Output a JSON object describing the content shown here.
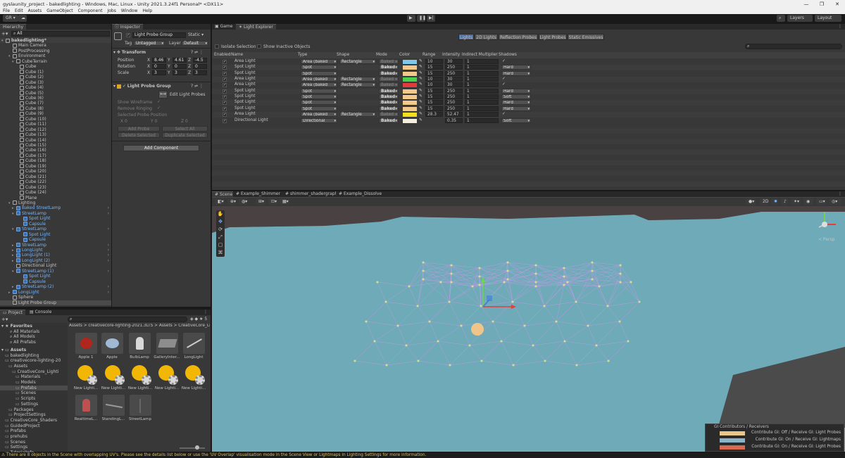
{
  "window": {
    "title": "gyslaunity_project - bakedlighting - Windows, Mac, Linux - Unity 2021.3.24f1 Personal* <DX11>",
    "controls": [
      "—",
      "❐",
      "✕"
    ]
  },
  "menu": [
    "File",
    "Edit",
    "Assets",
    "GameObject",
    "Component",
    "Jobs",
    "Window",
    "Help"
  ],
  "toolbar": {
    "account": "GR ▾",
    "layers": "Layers",
    "layout": "Layout"
  },
  "hierarchy": {
    "tab": "Hierarchy",
    "search_placeholder": "All",
    "items": [
      {
        "label": "bakedlighting*",
        "indent": 0,
        "kind": "scene",
        "arrow": "▾"
      },
      {
        "label": "Main Camera",
        "indent": 2,
        "kind": "obj"
      },
      {
        "label": "PostProcessing",
        "indent": 2,
        "kind": "obj"
      },
      {
        "label": "Environment",
        "indent": 2,
        "kind": "obj",
        "arrow": "▾"
      },
      {
        "label": "CubeTerrain",
        "indent": 3,
        "kind": "obj",
        "arrow": "▾"
      },
      {
        "label": "Cube",
        "indent": 4,
        "kind": "obj"
      },
      {
        "label": "Cube (1)",
        "indent": 4,
        "kind": "obj"
      },
      {
        "label": "Cube (2)",
        "indent": 4,
        "kind": "obj"
      },
      {
        "label": "Cube (3)",
        "indent": 4,
        "kind": "obj"
      },
      {
        "label": "Cube (4)",
        "indent": 4,
        "kind": "obj"
      },
      {
        "label": "Cube (5)",
        "indent": 4,
        "kind": "obj"
      },
      {
        "label": "Cube (6)",
        "indent": 4,
        "kind": "obj"
      },
      {
        "label": "Cube (7)",
        "indent": 4,
        "kind": "obj"
      },
      {
        "label": "Cube (8)",
        "indent": 4,
        "kind": "obj"
      },
      {
        "label": "Cube (9)",
        "indent": 4,
        "kind": "obj"
      },
      {
        "label": "Cube (10)",
        "indent": 4,
        "kind": "obj"
      },
      {
        "label": "Cube (11)",
        "indent": 4,
        "kind": "obj"
      },
      {
        "label": "Cube (12)",
        "indent": 4,
        "kind": "obj"
      },
      {
        "label": "Cube (13)",
        "indent": 4,
        "kind": "obj"
      },
      {
        "label": "Cube (14)",
        "indent": 4,
        "kind": "obj"
      },
      {
        "label": "Cube (15)",
        "indent": 4,
        "kind": "obj"
      },
      {
        "label": "Cube (16)",
        "indent": 4,
        "kind": "obj"
      },
      {
        "label": "Cube (17)",
        "indent": 4,
        "kind": "obj"
      },
      {
        "label": "Cube (18)",
        "indent": 4,
        "kind": "obj"
      },
      {
        "label": "Cube (19)",
        "indent": 4,
        "kind": "obj"
      },
      {
        "label": "Cube (20)",
        "indent": 4,
        "kind": "obj"
      },
      {
        "label": "Cube (21)",
        "indent": 4,
        "kind": "obj"
      },
      {
        "label": "Cube (22)",
        "indent": 4,
        "kind": "obj"
      },
      {
        "label": "Cube (23)",
        "indent": 4,
        "kind": "obj"
      },
      {
        "label": "Cube (24)",
        "indent": 4,
        "kind": "obj"
      },
      {
        "label": "Plane",
        "indent": 4,
        "kind": "obj"
      },
      {
        "label": "Lighting",
        "indent": 2,
        "kind": "obj",
        "arrow": "▾"
      },
      {
        "label": "Baked StreetLamp",
        "indent": 3,
        "kind": "prefab",
        "arrow": "▸"
      },
      {
        "label": "StreetLamp",
        "indent": 3,
        "kind": "prefab",
        "arrow": "▾"
      },
      {
        "label": "Spot Light",
        "indent": 5,
        "kind": "prefab"
      },
      {
        "label": "Capsule",
        "indent": 5,
        "kind": "prefab"
      },
      {
        "label": "StreetLamp",
        "indent": 3,
        "kind": "prefab",
        "arrow": "▾"
      },
      {
        "label": "Spot Light",
        "indent": 5,
        "kind": "prefab"
      },
      {
        "label": "Capsule",
        "indent": 5,
        "kind": "prefab"
      },
      {
        "label": "StreetLamp",
        "indent": 3,
        "kind": "prefab",
        "arrow": "▸"
      },
      {
        "label": "LongLight",
        "indent": 3,
        "kind": "prefab",
        "arrow": "▸"
      },
      {
        "label": "LongLight (1)",
        "indent": 3,
        "kind": "prefab",
        "arrow": "▸"
      },
      {
        "label": "LongLight (2)",
        "indent": 3,
        "kind": "prefab",
        "arrow": "▸"
      },
      {
        "label": "Directional Light",
        "indent": 3,
        "kind": "obj"
      },
      {
        "label": "StreetLamp (1)",
        "indent": 3,
        "kind": "prefab",
        "arrow": "▾"
      },
      {
        "label": "Spot Light",
        "indent": 5,
        "kind": "prefab"
      },
      {
        "label": "Capsule",
        "indent": 5,
        "kind": "prefab"
      },
      {
        "label": "StreetLamp (2)",
        "indent": 3,
        "kind": "prefab",
        "arrow": "▸"
      },
      {
        "label": "LongLight",
        "indent": 2,
        "kind": "prefab",
        "arrow": "▸"
      },
      {
        "label": "Sphere",
        "indent": 2,
        "kind": "obj"
      },
      {
        "label": "Light Probe Group",
        "indent": 2,
        "kind": "obj",
        "selected": true
      }
    ]
  },
  "inspector": {
    "tab": "Inspector",
    "object_name": "Light Probe Group",
    "static_label": "Static",
    "tag_label": "Tag",
    "tag_value": "Untagged",
    "layer_label": "Layer",
    "layer_value": "Default",
    "transform": {
      "title": "Transform",
      "position_label": "Position",
      "position": [
        "8.46",
        "4.61",
        "-4.5"
      ],
      "rotation_label": "Rotation",
      "rotation": [
        "0",
        "0",
        "0"
      ],
      "scale_label": "Scale",
      "scale": [
        "3",
        "3",
        "3"
      ]
    },
    "lpg": {
      "title": "Light Probe Group",
      "edit_button": "Edit Light Probes",
      "show_wireframe": "Show Wireframe",
      "remove_ringing": "Remove Ringing",
      "selected_probe_position": "Selected Probe Position",
      "probe_xyz": [
        "0",
        "0",
        "0"
      ],
      "add_probe": "Add Probe",
      "select_all": "Select All",
      "delete_selected": "Delete Selected",
      "duplicate_selected": "Duplicate Selected"
    },
    "add_component": "Add Component"
  },
  "light_explorer": {
    "tabs": [
      "Game",
      "Light Explorer"
    ],
    "categories": [
      "Lights",
      "2D Lights",
      "Reflection Probes",
      "Light Probes",
      "Static Emissives"
    ],
    "isolate_selection": "Isolate Selection",
    "show_inactive": "Show Inactive Objects",
    "columns": [
      "Enabled",
      "Name",
      "Type",
      "Shape",
      "Mode",
      "Color",
      "Range",
      "Intensity",
      "Indirect Multiplier",
      "Shadows"
    ],
    "rows": [
      {
        "name": "Area Light",
        "type": "Area (baked only)",
        "shape": "Rectangle",
        "mode": "Baked",
        "mode_dim": true,
        "color": "#7ec8ea",
        "range": "10",
        "intensity": "30",
        "indirect": "1",
        "shadows": "✓",
        "sh_drop": false
      },
      {
        "name": "Spot Light",
        "type": "Spot",
        "shape": "",
        "mode": "Baked",
        "mode_dim": false,
        "color": "#f3c98b",
        "range": "15",
        "intensity": "250",
        "indirect": "1",
        "shadows": "Hard Shadows",
        "sh_drop": true
      },
      {
        "name": "Spot Light",
        "type": "Spot",
        "shape": "",
        "mode": "Baked",
        "mode_dim": false,
        "color": "#f3c98b",
        "range": "15",
        "intensity": "250",
        "indirect": "1",
        "shadows": "Hard Shadows",
        "sh_drop": true
      },
      {
        "name": "Area Light",
        "type": "Area (baked only)",
        "shape": "Rectangle",
        "mode": "Baked",
        "mode_dim": true,
        "color": "#4ad04a",
        "range": "10",
        "intensity": "30",
        "indirect": "1",
        "shadows": "✓",
        "sh_drop": false
      },
      {
        "name": "Area Light",
        "type": "Area (baked only)",
        "shape": "Rectangle",
        "mode": "Baked",
        "mode_dim": true,
        "color": "#e03c3c",
        "range": "10",
        "intensity": "30",
        "indirect": "1",
        "shadows": "✓",
        "sh_drop": false
      },
      {
        "name": "Spot Light",
        "type": "Spot",
        "shape": "",
        "mode": "Baked",
        "mode_dim": false,
        "color": "#f3c98b",
        "range": "15",
        "intensity": "250",
        "indirect": "1",
        "shadows": "Hard Shadows",
        "sh_drop": true
      },
      {
        "name": "Spot Light",
        "type": "Spot",
        "shape": "",
        "mode": "Baked",
        "mode_dim": false,
        "color": "#f3c98b",
        "range": "15",
        "intensity": "250",
        "indirect": "1",
        "shadows": "Soft Shadows",
        "sh_drop": true
      },
      {
        "name": "Spot Light",
        "type": "Spot",
        "shape": "",
        "mode": "Baked",
        "mode_dim": false,
        "color": "#f3c98b",
        "range": "15",
        "intensity": "250",
        "indirect": "1",
        "shadows": "Hard Shadows",
        "sh_drop": true
      },
      {
        "name": "Spot Light",
        "type": "Spot",
        "shape": "",
        "mode": "Baked",
        "mode_dim": false,
        "color": "#f3c98b",
        "range": "15",
        "intensity": "250",
        "indirect": "1",
        "shadows": "Hard Shadows",
        "sh_drop": true
      },
      {
        "name": "Area Light",
        "type": "Area (baked only)",
        "shape": "Rectangle",
        "mode": "Baked",
        "mode_dim": true,
        "color": "#f0e020",
        "range": "28.3",
        "intensity": "52.47",
        "indirect": "1",
        "shadows": "✓",
        "sh_drop": false
      },
      {
        "name": "Directional Light",
        "type": "Directional",
        "shape": "",
        "mode": "Baked",
        "mode_dim": false,
        "color": "#f4efe0",
        "range": "",
        "intensity": "0.35",
        "indirect": "1",
        "shadows": "Soft Shadows",
        "sh_drop": true
      }
    ]
  },
  "scene": {
    "tabs": [
      "Scene",
      "Example_Shimmer",
      "shimmer_shadergraph",
      "Example_Dissolve"
    ],
    "mode_2d": "2D",
    "persp": "< Persp",
    "legend_title": "GI Contributors / Receivers",
    "legend": [
      {
        "color": "#e8c88a",
        "label": "Contribute GI: Off / Receive GI: Light Probes"
      },
      {
        "color": "#8ab4c8",
        "label": "Contribute GI: On / Receive GI: Lightmaps"
      },
      {
        "color": "#d86a50",
        "label": "Contribute GI: On / Receive GI: Light Probes"
      }
    ]
  },
  "project": {
    "tabs": [
      "Project",
      "Console"
    ],
    "breadcrumb": "Assets > creativecore-lighting-2021.3LTS > Assets > CreativeCore_Ligh",
    "badge": "5",
    "favorites_title": "Favorites",
    "favorites": [
      "All Materials",
      "All Models",
      "All Prefabs"
    ],
    "assets_title": "Assets",
    "tree": [
      {
        "label": "bakedlighting",
        "indent": 1
      },
      {
        "label": "creativecore-lighting-20",
        "indent": 1
      },
      {
        "label": "Assets",
        "indent": 2
      },
      {
        "label": "CreativeCore_Lighti",
        "indent": 3
      },
      {
        "label": "Materials",
        "indent": 4
      },
      {
        "label": "Models",
        "indent": 4
      },
      {
        "label": "Prefabs",
        "indent": 4,
        "selected": true
      },
      {
        "label": "Scenes",
        "indent": 4
      },
      {
        "label": "Scripts",
        "indent": 4
      },
      {
        "label": "Settings",
        "indent": 4
      },
      {
        "label": "Packages",
        "indent": 2
      },
      {
        "label": "ProjectSettings",
        "indent": 2
      },
      {
        "label": "CreativeCore_Shaders",
        "indent": 1
      },
      {
        "label": "GuidedProject",
        "indent": 1
      },
      {
        "label": "Prefabs",
        "indent": 1
      },
      {
        "label": "prehubs",
        "indent": 1
      },
      {
        "label": "Scenes",
        "indent": 1
      },
      {
        "label": "Settings",
        "indent": 1
      },
      {
        "label": "TutorialInfo",
        "indent": 1
      }
    ],
    "assets": [
      {
        "label": "Apple 1",
        "kind": "apple"
      },
      {
        "label": "Apple",
        "kind": "apple2"
      },
      {
        "label": "BulbLamp",
        "kind": "lamp"
      },
      {
        "label": "GalleryInter...",
        "kind": "box"
      },
      {
        "label": "LongLight",
        "kind": "long"
      },
      {
        "label": "New Lighti...",
        "kind": "bulb"
      },
      {
        "label": "New Lighti...",
        "kind": "bulb"
      },
      {
        "label": "New Lighti...",
        "kind": "bulb"
      },
      {
        "label": "New Lighti...",
        "kind": "bulb"
      },
      {
        "label": "New Lighti...",
        "kind": "bulb"
      },
      {
        "label": "RealtimeL...",
        "kind": "lamp2"
      },
      {
        "label": "StandingL...",
        "kind": "stand"
      },
      {
        "label": "StreetLamp",
        "kind": "street"
      }
    ]
  },
  "status": {
    "message": "There are 8 objects in the Scene with overlapping UV's. Please see the details list below or use the 'UV Overlap' visualisation mode in the Scene View or Lightmaps in Lighting Settings for more information."
  }
}
